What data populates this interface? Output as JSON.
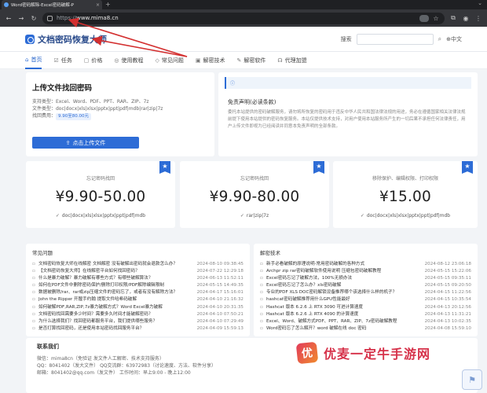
{
  "browser": {
    "tab_title": "Word密码解除-Excel密码破解-P",
    "tab_close": "×",
    "new_tab": "+",
    "url_scheme": "https://",
    "url_host": "www.mima8.cn"
  },
  "header": {
    "logo_text": "文档密码恢复大师",
    "search_label": "搜索",
    "lang": "中文"
  },
  "nav": [
    {
      "icon": "⌂",
      "label": "首页"
    },
    {
      "icon": "☑",
      "label": "任务"
    },
    {
      "icon": "▢",
      "label": "价格"
    },
    {
      "icon": "◎",
      "label": "使用教程"
    },
    {
      "icon": "◇",
      "label": "常见问题"
    },
    {
      "icon": "▣",
      "label": "解密技术"
    },
    {
      "icon": "✎",
      "label": "解密软件"
    },
    {
      "icon": "☊",
      "label": "代理加盟"
    }
  ],
  "upload": {
    "title": "上传文件找回密码",
    "support_formats": "支持类型：Excel、Word、PDF、PPT、RAR、ZIP、7z",
    "file_types": "文件类型：doc|docx|xls|xlsx|pptx|ppt|pdf|mdb|rar|zip|7z",
    "price_label": "找回费用：",
    "price_chip": "9.90至80.00元",
    "button_label": "点击上传文件"
  },
  "disclaimer": {
    "title": "免责声明(必读条款)",
    "text": "委托本站提供的密码破解服务，请勿将所恢复的密码用于违反中华人民共和国法律法规的用途，务必在遵循国家相关法律法规前提下使用本站提供的密码恢复服务。本站仅提供技术支持，对用户使用本站服务所产生的一切后果不承担任何法律责任，用户上传文件即视为已经阅读并同意本免责声明的全部条款。"
  },
  "pricing": [
    {
      "name": "忘记密码找回",
      "price": "¥9.90-50.00",
      "formats": "doc|docx|xls|xlsx|pptx|ppt|pdf|mdb"
    },
    {
      "name": "忘记密码找回",
      "price": "¥9.90-80.00",
      "formats": "rar|zip|7z"
    },
    {
      "name": "移除保护、编辑权限、打印权限",
      "price": "¥15.00",
      "formats": "doc|docx|xls|xlsx|pptx|ppt|pdf|mdb"
    }
  ],
  "faq": {
    "title": "常见问题",
    "items": [
      {
        "t": "文档密码恢复大师在线解密 文档解密 没有破解出密码就会退款怎么办？",
        "d": "2024-08-10 09:38:45"
      },
      {
        "t": "【文档密码恢复大师】在线解密平台如何找回密码？",
        "d": "2024-07-22 12:29:18"
      },
      {
        "t": "什么是暴力破解？暴力破解有哪些方式？有哪些破解算法？",
        "d": "2024-06-13 11:52:11"
      },
      {
        "t": "如何在PDF文件中删除密码保护/删除打印权限/PDF解除编辑限制",
        "d": "2024-05-15 14:49:35"
      },
      {
        "t": "数据被删除/rar、rar或zip压缩文件的密码忘了，或者有没有解除方法？",
        "d": "2024-04-17 15:16:01"
      },
      {
        "t": "John the Ripper 开膛手约翰 提取文件哈希码破解",
        "d": "2024-04-10 21:16:32"
      },
      {
        "t": "如何破解PDF,RAR,ZIP,7z暴力破解方式？Word Excel暴力破解",
        "d": "2024-04-10 20:31:35"
      },
      {
        "t": "文档密码找回需要多少时间？需要多久时间才能破解密码？",
        "d": "2024-04-10 07:50:21"
      },
      {
        "t": "为什么选择我们？找回密码都服务平台，我们提供哪些服务？",
        "d": "2024-04-10 07:29:49"
      },
      {
        "t": "是否打算找回密码，还是使用本站密码找回服务平台？",
        "d": "2024-04-09 15:59:13"
      }
    ]
  },
  "tech": {
    "title": "解密技术",
    "items": [
      {
        "t": "新手必看破解的原理说明-常用密码破解的各种方式",
        "d": "2024-08-12 23:06:18"
      },
      {
        "t": "Archpr zip rar密码破解软件使用说明 压缩包密码破解教程",
        "d": "2024-05-15 15:22:06"
      },
      {
        "t": "Excel密码忘记了破解方法，100%无损办法",
        "d": "2024-05-15 09:35:11"
      },
      {
        "t": "Excel密码忘记了怎么办？xls密码破解",
        "d": "2024-05-15 09:20:50"
      },
      {
        "t": "专业的PDF XLS DOC密码解锁设备推荐哪个该选择什么样的机子？",
        "d": "2024-04-15 11:22:56"
      },
      {
        "t": "hashcat密码破解推荐用什么GPU性能最好",
        "d": "2024-04-15 10:35:54"
      },
      {
        "t": "Hashcat 版本 6.2.6 上 RTX 3090 可进计算速度",
        "d": "2024-04-13 20:12:56"
      },
      {
        "t": "Hashcat 版本 6.2.6 上 RTX 4090 的计算速度",
        "d": "2024-04-13 11:31:21"
      },
      {
        "t": "Excel、Word、破解方式PDF、PPT、RAR、ZIP、7z密码破解教程",
        "d": "2024-04-13 10:02:35"
      },
      {
        "t": "Word密码忘了怎么解开？word 破解在线 doc 密码",
        "d": "2024-04-08 15:59:10"
      }
    ]
  },
  "contact": {
    "title": "联系我们",
    "line1": "微信：mima8cn（免验证 发文件人工解密、技术支持服务）",
    "line2": "QQ：8041402（发大文件）  QQ交流群：63972983（讨论速度、方法、软件分享）",
    "line3": "邮箱：8041402@qq.com（发文件）  工作时间：早上9:00 - 晚上12:00"
  },
  "watermark": {
    "logo_char": "优",
    "text": "优麦一定牛手游网"
  },
  "colors": {
    "accent": "#2d6cd6",
    "arrow": "#d32f2f"
  }
}
